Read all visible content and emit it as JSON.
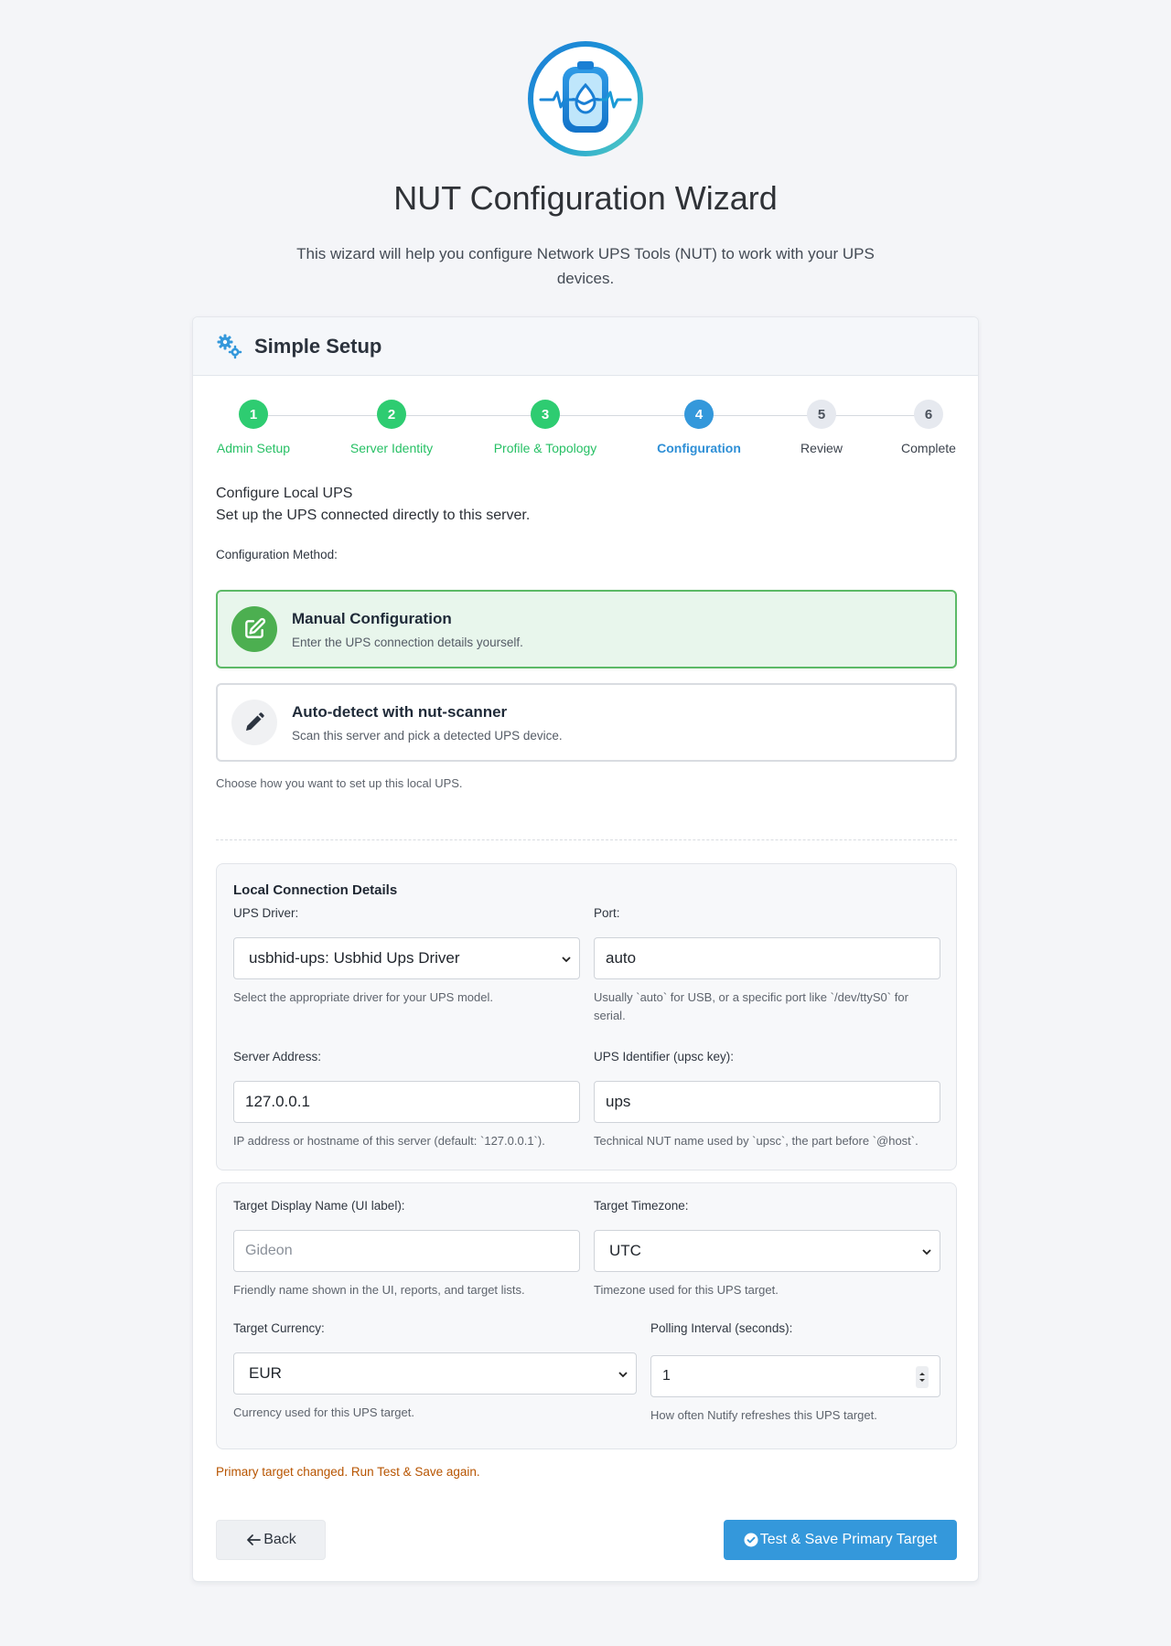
{
  "header": {
    "title": "NUT Configuration Wizard",
    "intro": "This wizard will help you configure Network UPS Tools (NUT) to work with your UPS devices.",
    "logo_icon": "battery-wave-logo"
  },
  "card": {
    "title": "Simple Setup",
    "title_icon": "gears-icon"
  },
  "stepper": {
    "steps": [
      {
        "number": "1",
        "label": "Admin Setup",
        "state": "done"
      },
      {
        "number": "2",
        "label": "Server Identity",
        "state": "done"
      },
      {
        "number": "3",
        "label": "Profile & Topology",
        "state": "done"
      },
      {
        "number": "4",
        "label": "Configuration",
        "state": "active"
      },
      {
        "number": "5",
        "label": "Review",
        "state": "todo"
      },
      {
        "number": "6",
        "label": "Complete",
        "state": "todo"
      }
    ]
  },
  "section": {
    "heading": "Configure Local UPS",
    "subheading": "Set up the UPS connected directly to this server.",
    "method_label": "Configuration Method:",
    "method_help": "Choose how you want to set up this local UPS."
  },
  "methods": [
    {
      "title": "Manual Configuration",
      "description": "Enter the UPS connection details yourself.",
      "selected": true,
      "icon": "edit-square-icon"
    },
    {
      "title": "Auto-detect with nut-scanner",
      "description": "Scan this server and pick a detected UPS device.",
      "selected": false,
      "icon": "pencil-icon"
    }
  ],
  "connection": {
    "title": "Local Connection Details",
    "driver": {
      "label": "UPS Driver:",
      "value": "usbhid-ups: Usbhid Ups Driver",
      "help": "Select the appropriate driver for your UPS model."
    },
    "port": {
      "label": "Port:",
      "value": "auto",
      "help": "Usually `auto` for USB, or a specific port like `/dev/ttyS0` for serial."
    },
    "server_address": {
      "label": "Server Address:",
      "value": "127.0.0.1",
      "help": "IP address or hostname of this server (default: `127.0.0.1`)."
    },
    "ups_identifier": {
      "label": "UPS Identifier (upsc key):",
      "value": "ups",
      "help": "Technical NUT name used by `upsc`, the part before `@host`."
    }
  },
  "target": {
    "display_name": {
      "label": "Target Display Name (UI label):",
      "placeholder": "Gideon",
      "help": "Friendly name shown in the UI, reports, and target lists."
    },
    "timezone": {
      "label": "Target Timezone:",
      "value": "UTC",
      "help": "Timezone used for this UPS target."
    },
    "currency": {
      "label": "Target Currency:",
      "value": "EUR",
      "help": "Currency used for this UPS target."
    },
    "polling": {
      "label": "Polling Interval (seconds):",
      "value": "1",
      "help": "How often Nutify refreshes this UPS target."
    }
  },
  "warning": "Primary target changed. Run Test & Save again.",
  "actions": {
    "back": "Back",
    "save": "Test & Save Primary Target"
  },
  "colors": {
    "done": "#2ecc71",
    "active": "#3498db",
    "todo": "#e6e9ef",
    "selected_bg": "#e8f6ec",
    "selected_border": "#5cba67",
    "primary_button": "#3498db",
    "warning": "#b75400"
  }
}
